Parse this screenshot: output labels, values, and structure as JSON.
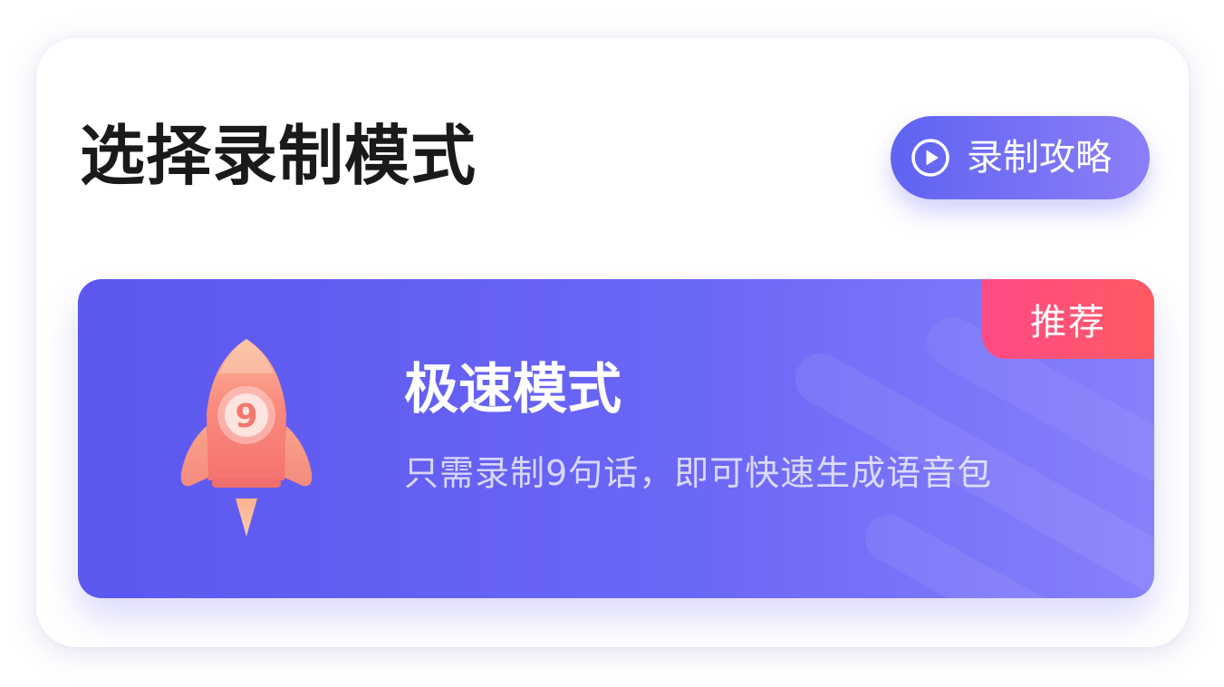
{
  "header": {
    "title": "选择录制模式",
    "guide_button_label": "录制攻略",
    "guide_button_icon": "play-circle-icon"
  },
  "mode_card": {
    "badge": "推荐",
    "title": "极速模式",
    "description": "只需录制9句话，即可快速生成语音包",
    "icon": "rocket-icon",
    "rocket_number": "9"
  },
  "colors": {
    "accent_start": "#5f63f2",
    "accent_end": "#8b7ff8",
    "card_start": "#5c57ef",
    "card_end": "#8680fb",
    "badge_start": "#ff4a86",
    "badge_end": "#ff5a62",
    "title_text": "#1a1a1a"
  }
}
